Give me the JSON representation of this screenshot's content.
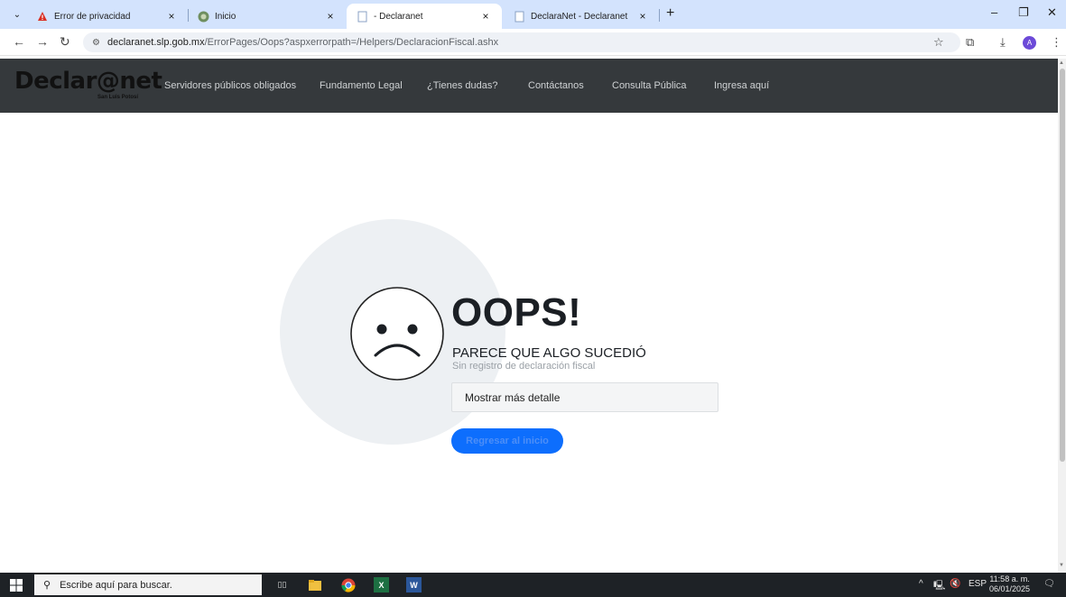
{
  "browser": {
    "tabs": [
      {
        "title": "Error de privacidad",
        "active": false
      },
      {
        "title": "Inicio",
        "active": false
      },
      {
        "title": "- Declaranet",
        "active": true
      },
      {
        "title": "DeclaraNet - Declaranet",
        "active": false
      }
    ],
    "new_tab_label": "+",
    "address": {
      "host": "declaranet.slp.gob.mx",
      "path": "/ErrorPages/Oops?aspxerrorpath=/Helpers/DeclaracionFiscal.ashx"
    },
    "profile_initial": "A"
  },
  "site": {
    "logo_text": "Declar@net",
    "logo_subtitle": "San Luis Potosí",
    "nav": [
      "Servidores públicos obligados",
      "Fundamento Legal",
      "¿Tienes dudas?",
      "Contáctanos",
      "Consulta Pública",
      "Ingresa aquí"
    ]
  },
  "error": {
    "heading": "OOPS!",
    "subtitle": "PARECE QUE ALGO SUCEDIÓ",
    "detail": "Sin registro de declaración fiscal",
    "show_more_label": "Mostrar más detalle",
    "back_button_label": "Regresar al inicio"
  },
  "taskbar": {
    "search_placeholder": "Escribe aquí para buscar.",
    "language": "ESP",
    "time": "11:58 a. m.",
    "date": "06/01/2025"
  },
  "colors": {
    "tabstrip": "#d3e3fd",
    "navbar": "#35393c",
    "primary_button": "#0d6efd",
    "taskbar": "#1e2226"
  }
}
